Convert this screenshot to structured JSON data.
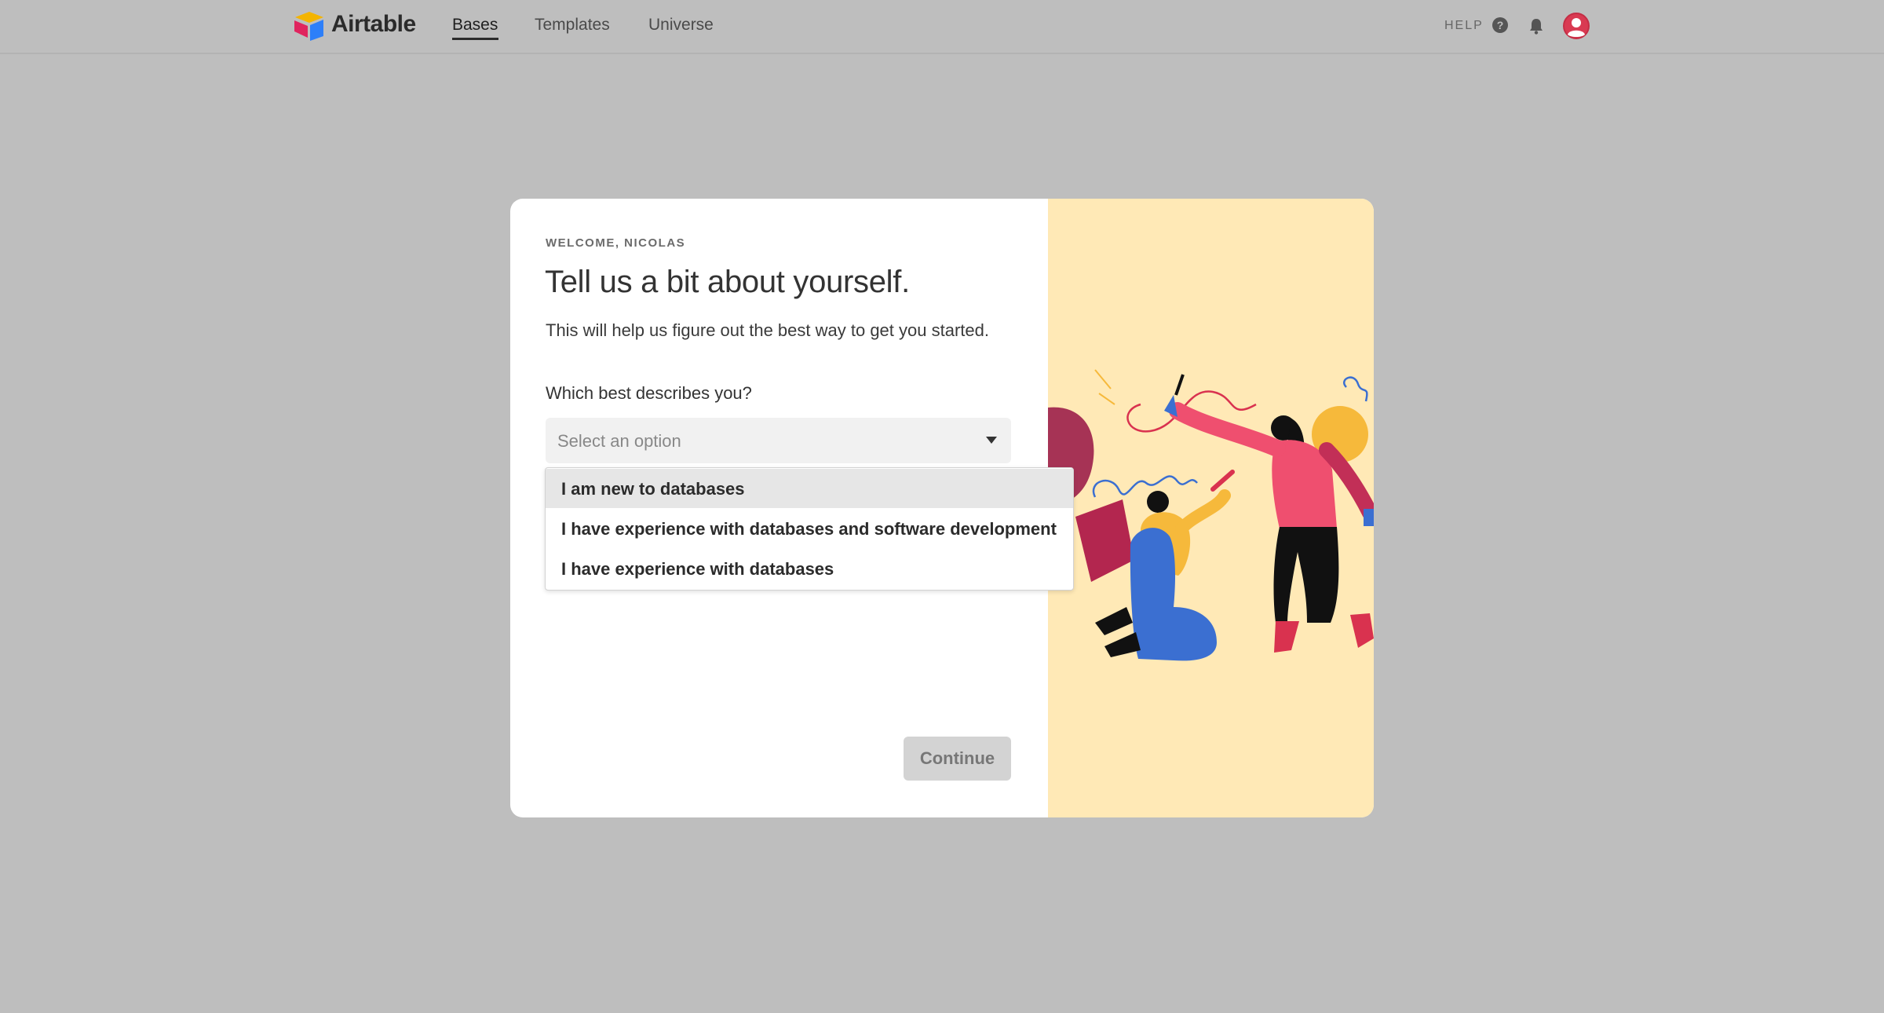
{
  "app": {
    "brand": "Airtable",
    "nav": [
      "Bases",
      "Templates",
      "Universe"
    ],
    "help_label": "HELP"
  },
  "modal": {
    "eyebrow": "WELCOME, NICOLAS",
    "title": "Tell us a bit about yourself.",
    "subtitle": "This will help us figure out the best way to get you started.",
    "question": "Which best describes you?",
    "select_placeholder": "Select an option",
    "options": [
      "I am new to databases",
      "I have experience with databases and software development",
      "I have experience with databases"
    ],
    "continue_label": "Continue"
  },
  "icons": {
    "help": "question-circle-icon",
    "notifications": "bell-icon",
    "account": "user-avatar-icon",
    "logo": "airtable-logo-icon",
    "dropdown": "caret-down-icon"
  },
  "colors": {
    "backdrop": "#bebebe",
    "modal_bg": "#ffffff",
    "illustration_bg": "#ffe9b6",
    "avatar": "#d93a52"
  }
}
